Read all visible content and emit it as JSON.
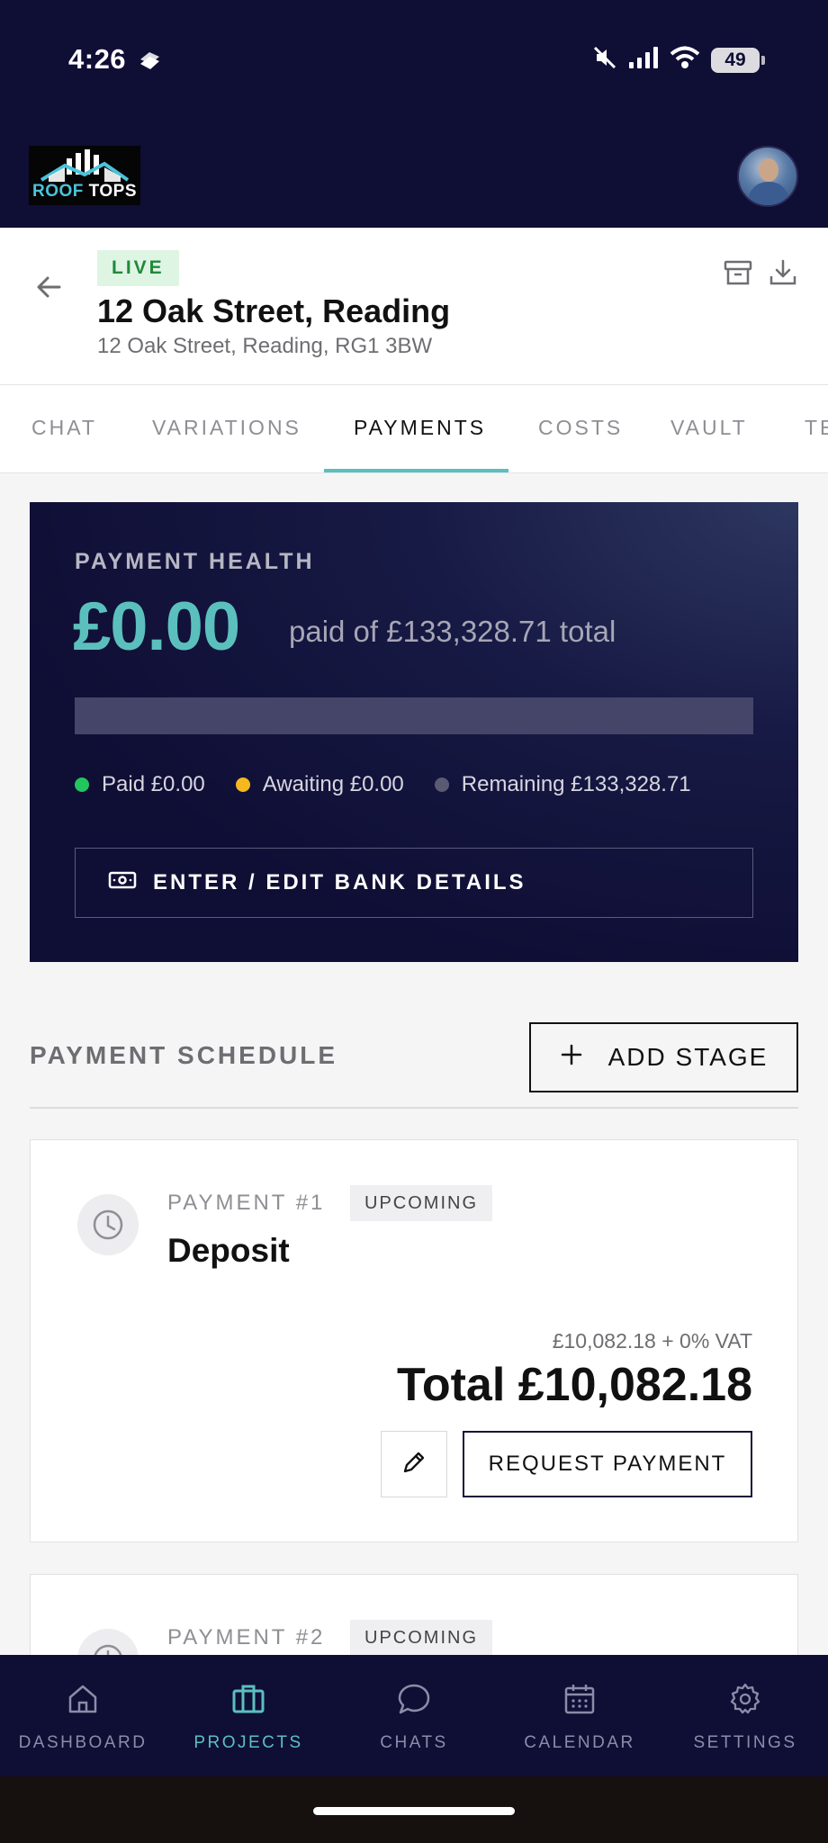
{
  "status_bar": {
    "time": "4:26",
    "battery": "49"
  },
  "brand": {
    "logo_part1": "ROOF",
    "logo_part2": "TOPS"
  },
  "project": {
    "badge": "LIVE",
    "title": "12 Oak Street, Reading",
    "address": "12 Oak Street, Reading, RG1 3BW"
  },
  "tabs": [
    {
      "label": "CHAT"
    },
    {
      "label": "VARIATIONS"
    },
    {
      "label": "PAYMENTS"
    },
    {
      "label": "COSTS"
    },
    {
      "label": "VAULT"
    },
    {
      "label": "TE"
    }
  ],
  "active_tab": "PAYMENTS",
  "payment_health": {
    "label": "PAYMENT HEALTH",
    "amount_paid": "£0.00",
    "of_total": "paid of £133,328.71 total",
    "paid_fraction": 0,
    "legend": {
      "paid": "Paid £0.00",
      "awaiting": "Awaiting £0.00",
      "remaining": "Remaining £133,328.71"
    },
    "bank_button": "ENTER / EDIT BANK DETAILS"
  },
  "colors": {
    "accent": "#5bc0bd",
    "navy": "#0f0e35",
    "paid": "#22c55e",
    "awaiting": "#f5b81f",
    "remaining": "#5b5a73"
  },
  "schedule": {
    "title": "PAYMENT SCHEDULE",
    "add_stage": "ADD STAGE",
    "payments": [
      {
        "number": "PAYMENT #1",
        "status": "UPCOMING",
        "name": "Deposit",
        "subtotal": "£10,082.18 + 0% VAT",
        "total": "Total £10,082.18",
        "request_button": "REQUEST PAYMENT"
      },
      {
        "number": "PAYMENT #2",
        "status": "UPCOMING"
      }
    ]
  },
  "nav": [
    {
      "label": "DASHBOARD",
      "icon": "home-icon"
    },
    {
      "label": "PROJECTS",
      "icon": "briefcase-icon"
    },
    {
      "label": "CHATS",
      "icon": "chat-icon"
    },
    {
      "label": "CALENDAR",
      "icon": "calendar-icon"
    },
    {
      "label": "SETTINGS",
      "icon": "gear-icon"
    }
  ],
  "active_nav": "PROJECTS"
}
